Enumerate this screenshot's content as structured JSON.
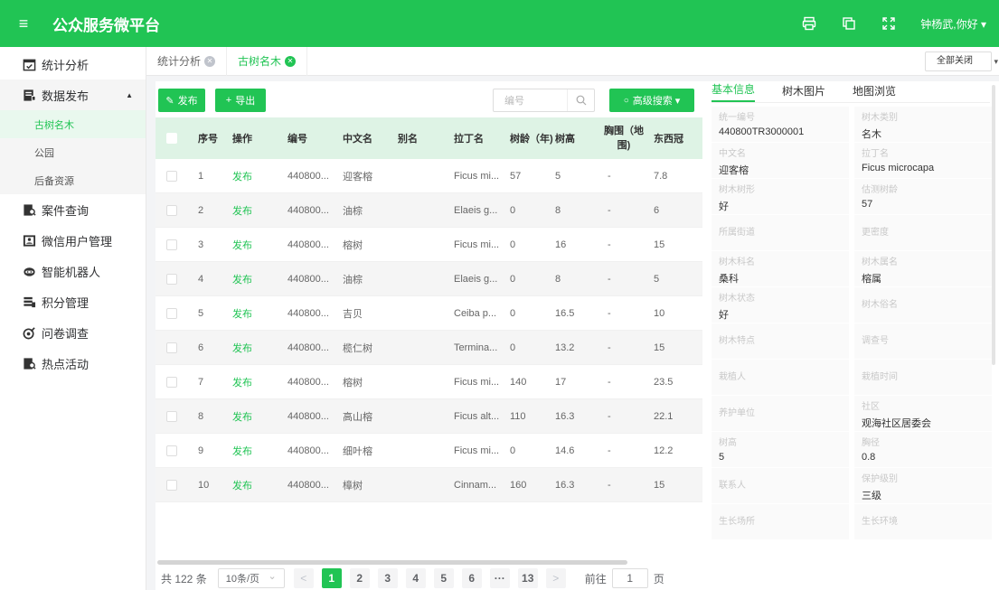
{
  "app": {
    "title": "公众服务微平台",
    "user_greeting": "钟杨武,你好 ▾"
  },
  "header_icons": [
    "print-icon",
    "copy-icon",
    "fullscreen-icon"
  ],
  "sidebar": {
    "items": [
      {
        "label": "统计分析",
        "icon": "calendar-check-icon"
      },
      {
        "label": "数据发布",
        "icon": "publish-icon"
      },
      {
        "label": "案件查询",
        "icon": "search-doc-icon"
      },
      {
        "label": "微信用户管理",
        "icon": "user-card-icon"
      },
      {
        "label": "智能机器人",
        "icon": "robot-icon"
      },
      {
        "label": "积分管理",
        "icon": "points-icon"
      },
      {
        "label": "问卷调查",
        "icon": "survey-icon"
      },
      {
        "label": "热点活动",
        "icon": "hot-activity-icon"
      }
    ],
    "sub_items": [
      {
        "label": "古树名木"
      },
      {
        "label": "公园"
      },
      {
        "label": "后备资源"
      }
    ]
  },
  "tabs": [
    {
      "label": "统计分析"
    },
    {
      "label": "古树名木"
    }
  ],
  "close_all": "全部关闭",
  "toolbar": {
    "publish": "发布",
    "export": "导出",
    "search_placeholder": "编号",
    "advanced_search": "高级搜索 ▾"
  },
  "table": {
    "headers": [
      "序号",
      "操作",
      "编号",
      "中文名",
      "别名",
      "拉丁名",
      "树龄（年)",
      "树高",
      "胸围（地围)",
      "东西冠"
    ],
    "rows": [
      [
        "1",
        "发布",
        "440800...",
        "迎客榕",
        "",
        "Ficus mi...",
        "57",
        "5",
        "-",
        "7.8"
      ],
      [
        "2",
        "发布",
        "440800...",
        "油棕",
        "",
        "Elaeis g...",
        "0",
        "8",
        "-",
        "6"
      ],
      [
        "3",
        "发布",
        "440800...",
        "榕树",
        "",
        "Ficus mi...",
        "0",
        "16",
        "-",
        "15"
      ],
      [
        "4",
        "发布",
        "440800...",
        "油棕",
        "",
        "Elaeis g...",
        "0",
        "8",
        "-",
        "5"
      ],
      [
        "5",
        "发布",
        "440800...",
        "吉贝",
        "",
        "Ceiba p...",
        "0",
        "16.5",
        "-",
        "10"
      ],
      [
        "6",
        "发布",
        "440800...",
        "榄仁树",
        "",
        "Termina...",
        "0",
        "13.2",
        "-",
        "15"
      ],
      [
        "7",
        "发布",
        "440800...",
        "榕树",
        "",
        "Ficus mi...",
        "140",
        "17",
        "-",
        "23.5"
      ],
      [
        "8",
        "发布",
        "440800...",
        "高山榕",
        "",
        "Ficus alt...",
        "110",
        "16.3",
        "-",
        "22.1"
      ],
      [
        "9",
        "发布",
        "440800...",
        "细叶榕",
        "",
        "Ficus mi...",
        "0",
        "14.6",
        "-",
        "12.2"
      ],
      [
        "10",
        "发布",
        "440800...",
        "樟树",
        "",
        "Cinnam...",
        "160",
        "16.3",
        "-",
        "15"
      ]
    ]
  },
  "pager": {
    "total": "共 122 条",
    "page_size": "10条/页",
    "prev": "<",
    "pages": [
      "1",
      "2",
      "3",
      "4",
      "5",
      "6",
      "···",
      "13"
    ],
    "next": ">",
    "goto_label": "前往",
    "goto_value": "1",
    "goto_suffix": "页"
  },
  "detail": {
    "tabs": [
      "基本信息",
      "树木图片",
      "地图浏览"
    ],
    "fields": [
      {
        "label": "统一编号",
        "value": "440800TR3000001"
      },
      {
        "label": "树木类别",
        "value": "名木"
      },
      {
        "label": "中文名",
        "value": "迎客榕"
      },
      {
        "label": "拉丁名",
        "value": "Ficus microcapa"
      },
      {
        "label": "树木树形",
        "value": "好"
      },
      {
        "label": "估测树龄",
        "value": "57"
      },
      {
        "label": "所属街道",
        "value": ""
      },
      {
        "label": "更密度",
        "value": ""
      },
      {
        "label": "树木科名",
        "value": "桑科"
      },
      {
        "label": "树木属名",
        "value": "榕属"
      },
      {
        "label": "树木状态",
        "value": "好"
      },
      {
        "label": "树木俗名",
        "value": ""
      },
      {
        "label": "树木特点",
        "value": ""
      },
      {
        "label": "调查号",
        "value": ""
      },
      {
        "label": "栽植人",
        "value": ""
      },
      {
        "label": "栽植时间",
        "value": ""
      },
      {
        "label": "养护单位",
        "value": ""
      },
      {
        "label": "社区",
        "value": "观海社区居委会"
      },
      {
        "label": "树高",
        "value": "5"
      },
      {
        "label": "胸径",
        "value": "0.8"
      },
      {
        "label": "联系人",
        "value": ""
      },
      {
        "label": "保护级别",
        "value": "三级"
      },
      {
        "label": "生长场所",
        "value": ""
      },
      {
        "label": "生长环境",
        "value": ""
      }
    ]
  },
  "colors": {
    "brand": "#21c454",
    "table_header": "#def3e5"
  }
}
